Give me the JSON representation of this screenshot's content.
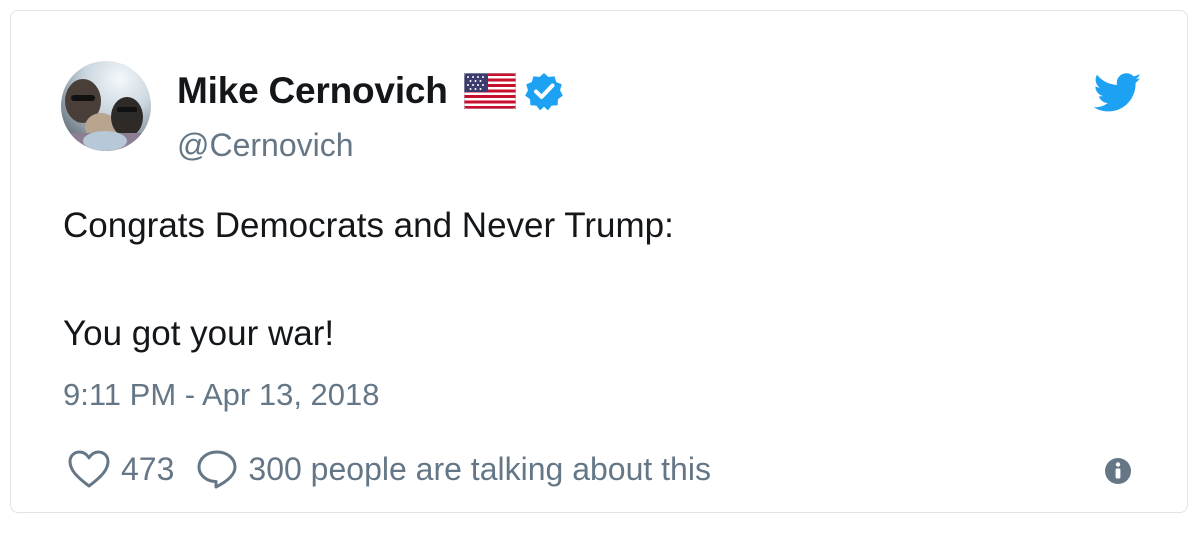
{
  "tweet": {
    "display_name": "Mike Cernovich",
    "handle": "@Cernovich",
    "text_line_1": "Congrats Democrats and Never Trump:",
    "text_line_2": "You got your war!",
    "timestamp": "9:11 PM - Apr 13, 2018",
    "likes": "473",
    "talking_label": "300 people are talking about this"
  },
  "icons": {
    "flag": "us-flag-icon",
    "verified": "verified-badge-icon",
    "bird": "twitter-bird-icon",
    "heart": "heart-icon",
    "reply": "speech-bubble-icon",
    "info": "info-icon"
  },
  "colors": {
    "accent": "#1da1f2",
    "verified": "#1da1f2",
    "text": "#14171a",
    "muted": "#657786",
    "border": "#dfe3e8"
  }
}
